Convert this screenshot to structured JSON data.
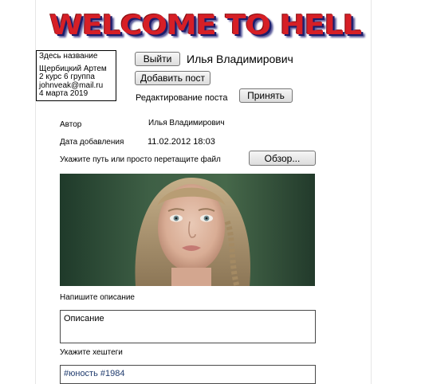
{
  "banner": {
    "title": "WELCOME TO HELL"
  },
  "profile": {
    "lines_top": "Здесь название",
    "name": "Щербицкий Артем",
    "group": "2 курс 6 группа",
    "email": "johnveak@mail.ru",
    "date": "4 марта 2019"
  },
  "header": {
    "logout_label": "Выйти",
    "user_name": "Илья Владимирович",
    "add_post_label": "Добавить пост",
    "edit_post_text": "Редактирование поста",
    "accept_label": "Принять"
  },
  "form": {
    "author_label": "Автор",
    "author_value": "Илья Владимирович",
    "date_label": "Дата добавления",
    "date_value": "11.02.2012 18:03",
    "file_label": "Укажите путь или просто перетащите файл",
    "browse_label": "Обзор...",
    "description_label": "Напишите описание",
    "description_value": "Описание",
    "hashtags_label": "Укажите хештеги",
    "hashtags_value": "#юность #1984"
  },
  "colors": {
    "accent_red": "#d61f26",
    "banner_shadow": "#1c1c6a",
    "hashtag_text": "#1f3b6e"
  }
}
